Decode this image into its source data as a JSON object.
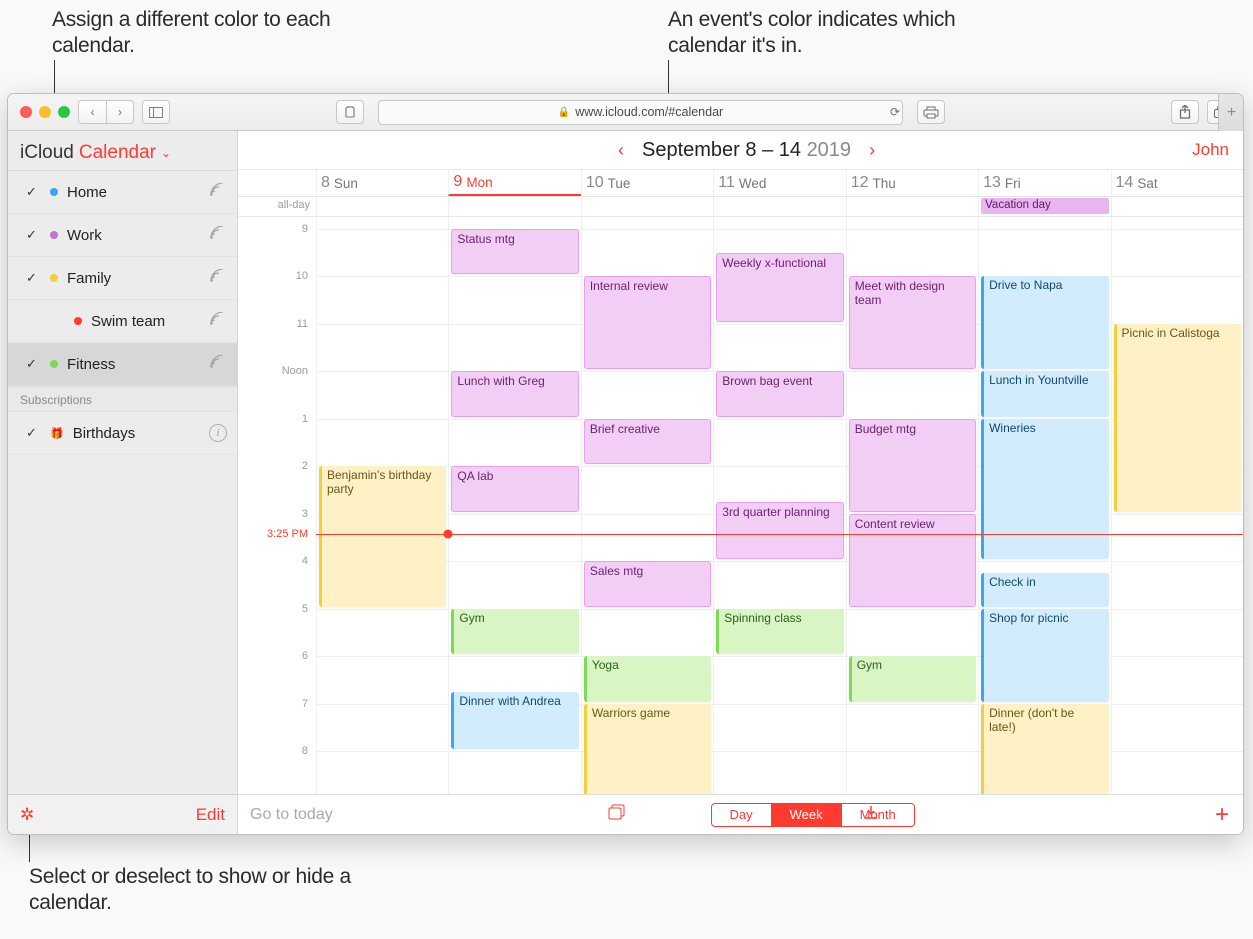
{
  "annotations": {
    "topLeft": "Assign a different color to each calendar.",
    "topRight": "An event's color indicates which calendar it's in.",
    "bottom": "Select or deselect to show or hide a calendar."
  },
  "browser": {
    "url": "www.icloud.com/#calendar"
  },
  "header": {
    "service": "iCloud",
    "app": "Calendar",
    "dateRange": "September 8 – 14",
    "year": "2019",
    "user": "John"
  },
  "sidebar": {
    "subscriptionsLabel": "Subscriptions",
    "editLabel": "Edit",
    "calendars": [
      {
        "name": "Home",
        "color": "#3aa6ef",
        "checked": true,
        "shared": true,
        "indent": false
      },
      {
        "name": "Work",
        "color": "#c771d6",
        "checked": true,
        "shared": true,
        "indent": false
      },
      {
        "name": "Family",
        "color": "#f1cf3f",
        "checked": true,
        "shared": true,
        "indent": false
      },
      {
        "name": "Swim team",
        "color": "#ff3b30",
        "checked": false,
        "shared": true,
        "indent": true
      },
      {
        "name": "Fitness",
        "color": "#7ed957",
        "checked": true,
        "shared": true,
        "indent": false,
        "selected": true
      }
    ],
    "subscriptions": [
      {
        "name": "Birthdays",
        "icon": "gift",
        "checked": true
      }
    ]
  },
  "week": {
    "alldayLabel": "all-day",
    "hours": [
      "9",
      "10",
      "11",
      "Noon",
      "1",
      "2",
      "3",
      "4",
      "5",
      "6",
      "7",
      "8"
    ],
    "nowLabel": "3:25 PM",
    "days": [
      {
        "num": "8",
        "name": "Sun",
        "today": false
      },
      {
        "num": "9",
        "name": "Mon",
        "today": true
      },
      {
        "num": "10",
        "name": "Tue",
        "today": false
      },
      {
        "num": "11",
        "name": "Wed",
        "today": false
      },
      {
        "num": "12",
        "name": "Thu",
        "today": false
      },
      {
        "num": "13",
        "name": "Fri",
        "today": false
      },
      {
        "num": "14",
        "name": "Sat",
        "today": false
      }
    ],
    "alldayEvents": [
      {
        "day": 5,
        "title": "Vacation day",
        "color": "purple"
      }
    ],
    "events": [
      {
        "day": 0,
        "title": "Benjamin's birthday party",
        "color": "yellow",
        "startH": 14,
        "endH": 17
      },
      {
        "day": 1,
        "title": "Status mtg",
        "color": "purple",
        "startH": 9,
        "endH": 10
      },
      {
        "day": 1,
        "title": "Lunch with Greg",
        "color": "purple",
        "startH": 12,
        "endH": 13
      },
      {
        "day": 1,
        "title": "QA lab",
        "color": "purple",
        "startH": 14,
        "endH": 15
      },
      {
        "day": 1,
        "title": "Gym",
        "color": "green",
        "startH": 17,
        "endH": 18
      },
      {
        "day": 1,
        "title": "Dinner with Andrea",
        "color": "blue",
        "startH": 18.75,
        "endH": 20
      },
      {
        "day": 2,
        "title": "Internal review",
        "color": "purple",
        "startH": 10,
        "endH": 12
      },
      {
        "day": 2,
        "title": "Brief creative",
        "color": "purple",
        "startH": 13,
        "endH": 14
      },
      {
        "day": 2,
        "title": "Sales mtg",
        "color": "purple",
        "startH": 16,
        "endH": 17
      },
      {
        "day": 2,
        "title": "Yoga",
        "color": "green",
        "startH": 18,
        "endH": 19
      },
      {
        "day": 2,
        "title": "Warriors game",
        "color": "yellow",
        "startH": 19,
        "endH": 21
      },
      {
        "day": 3,
        "title": "Weekly x-functional",
        "color": "purple",
        "startH": 9.5,
        "endH": 11
      },
      {
        "day": 3,
        "title": "Brown bag event",
        "color": "purple",
        "startH": 12,
        "endH": 13
      },
      {
        "day": 3,
        "title": "3rd quarter planning",
        "color": "purple",
        "startH": 14.75,
        "endH": 16
      },
      {
        "day": 3,
        "title": "Spinning class",
        "color": "green",
        "startH": 17,
        "endH": 18
      },
      {
        "day": 4,
        "title": "Meet with design team",
        "color": "purple",
        "startH": 10,
        "endH": 12
      },
      {
        "day": 4,
        "title": "Budget mtg",
        "color": "purple",
        "startH": 13,
        "endH": 15
      },
      {
        "day": 4,
        "title": "Content review",
        "color": "purple",
        "startH": 15,
        "endH": 17
      },
      {
        "day": 4,
        "title": "Gym",
        "color": "green",
        "startH": 18,
        "endH": 19
      },
      {
        "day": 5,
        "title": "Drive to Napa",
        "color": "blue",
        "startH": 10,
        "endH": 12
      },
      {
        "day": 5,
        "title": "Lunch in Yountville",
        "color": "blue",
        "startH": 12,
        "endH": 13
      },
      {
        "day": 5,
        "title": "Wineries",
        "color": "blue",
        "startH": 13,
        "endH": 16
      },
      {
        "day": 5,
        "title": "Check in",
        "color": "blue",
        "startH": 16.25,
        "endH": 17
      },
      {
        "day": 5,
        "title": "Shop for picnic",
        "color": "blue",
        "startH": 17,
        "endH": 19
      },
      {
        "day": 5,
        "title": "Dinner (don't be late!)",
        "color": "yellow",
        "startH": 19,
        "endH": 21
      },
      {
        "day": 6,
        "title": "Picnic in Calistoga",
        "color": "yellow",
        "startH": 11,
        "endH": 15
      }
    ]
  },
  "footer": {
    "goToday": "Go to today",
    "views": [
      "Day",
      "Week",
      "Month"
    ],
    "activeView": 1
  }
}
